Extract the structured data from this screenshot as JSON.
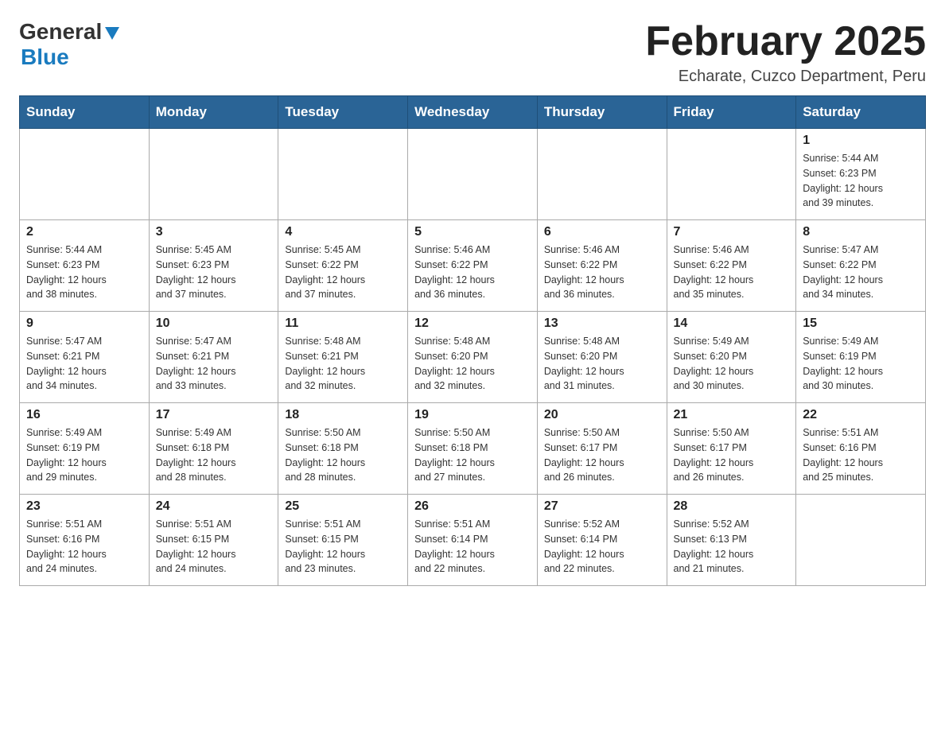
{
  "header": {
    "logo_general": "General",
    "logo_blue": "Blue",
    "month_title": "February 2025",
    "location": "Echarate, Cuzco Department, Peru"
  },
  "weekdays": [
    "Sunday",
    "Monday",
    "Tuesday",
    "Wednesday",
    "Thursday",
    "Friday",
    "Saturday"
  ],
  "weeks": [
    [
      {
        "day": "",
        "info": ""
      },
      {
        "day": "",
        "info": ""
      },
      {
        "day": "",
        "info": ""
      },
      {
        "day": "",
        "info": ""
      },
      {
        "day": "",
        "info": ""
      },
      {
        "day": "",
        "info": ""
      },
      {
        "day": "1",
        "info": "Sunrise: 5:44 AM\nSunset: 6:23 PM\nDaylight: 12 hours\nand 39 minutes."
      }
    ],
    [
      {
        "day": "2",
        "info": "Sunrise: 5:44 AM\nSunset: 6:23 PM\nDaylight: 12 hours\nand 38 minutes."
      },
      {
        "day": "3",
        "info": "Sunrise: 5:45 AM\nSunset: 6:23 PM\nDaylight: 12 hours\nand 37 minutes."
      },
      {
        "day": "4",
        "info": "Sunrise: 5:45 AM\nSunset: 6:22 PM\nDaylight: 12 hours\nand 37 minutes."
      },
      {
        "day": "5",
        "info": "Sunrise: 5:46 AM\nSunset: 6:22 PM\nDaylight: 12 hours\nand 36 minutes."
      },
      {
        "day": "6",
        "info": "Sunrise: 5:46 AM\nSunset: 6:22 PM\nDaylight: 12 hours\nand 36 minutes."
      },
      {
        "day": "7",
        "info": "Sunrise: 5:46 AM\nSunset: 6:22 PM\nDaylight: 12 hours\nand 35 minutes."
      },
      {
        "day": "8",
        "info": "Sunrise: 5:47 AM\nSunset: 6:22 PM\nDaylight: 12 hours\nand 34 minutes."
      }
    ],
    [
      {
        "day": "9",
        "info": "Sunrise: 5:47 AM\nSunset: 6:21 PM\nDaylight: 12 hours\nand 34 minutes."
      },
      {
        "day": "10",
        "info": "Sunrise: 5:47 AM\nSunset: 6:21 PM\nDaylight: 12 hours\nand 33 minutes."
      },
      {
        "day": "11",
        "info": "Sunrise: 5:48 AM\nSunset: 6:21 PM\nDaylight: 12 hours\nand 32 minutes."
      },
      {
        "day": "12",
        "info": "Sunrise: 5:48 AM\nSunset: 6:20 PM\nDaylight: 12 hours\nand 32 minutes."
      },
      {
        "day": "13",
        "info": "Sunrise: 5:48 AM\nSunset: 6:20 PM\nDaylight: 12 hours\nand 31 minutes."
      },
      {
        "day": "14",
        "info": "Sunrise: 5:49 AM\nSunset: 6:20 PM\nDaylight: 12 hours\nand 30 minutes."
      },
      {
        "day": "15",
        "info": "Sunrise: 5:49 AM\nSunset: 6:19 PM\nDaylight: 12 hours\nand 30 minutes."
      }
    ],
    [
      {
        "day": "16",
        "info": "Sunrise: 5:49 AM\nSunset: 6:19 PM\nDaylight: 12 hours\nand 29 minutes."
      },
      {
        "day": "17",
        "info": "Sunrise: 5:49 AM\nSunset: 6:18 PM\nDaylight: 12 hours\nand 28 minutes."
      },
      {
        "day": "18",
        "info": "Sunrise: 5:50 AM\nSunset: 6:18 PM\nDaylight: 12 hours\nand 28 minutes."
      },
      {
        "day": "19",
        "info": "Sunrise: 5:50 AM\nSunset: 6:18 PM\nDaylight: 12 hours\nand 27 minutes."
      },
      {
        "day": "20",
        "info": "Sunrise: 5:50 AM\nSunset: 6:17 PM\nDaylight: 12 hours\nand 26 minutes."
      },
      {
        "day": "21",
        "info": "Sunrise: 5:50 AM\nSunset: 6:17 PM\nDaylight: 12 hours\nand 26 minutes."
      },
      {
        "day": "22",
        "info": "Sunrise: 5:51 AM\nSunset: 6:16 PM\nDaylight: 12 hours\nand 25 minutes."
      }
    ],
    [
      {
        "day": "23",
        "info": "Sunrise: 5:51 AM\nSunset: 6:16 PM\nDaylight: 12 hours\nand 24 minutes."
      },
      {
        "day": "24",
        "info": "Sunrise: 5:51 AM\nSunset: 6:15 PM\nDaylight: 12 hours\nand 24 minutes."
      },
      {
        "day": "25",
        "info": "Sunrise: 5:51 AM\nSunset: 6:15 PM\nDaylight: 12 hours\nand 23 minutes."
      },
      {
        "day": "26",
        "info": "Sunrise: 5:51 AM\nSunset: 6:14 PM\nDaylight: 12 hours\nand 22 minutes."
      },
      {
        "day": "27",
        "info": "Sunrise: 5:52 AM\nSunset: 6:14 PM\nDaylight: 12 hours\nand 22 minutes."
      },
      {
        "day": "28",
        "info": "Sunrise: 5:52 AM\nSunset: 6:13 PM\nDaylight: 12 hours\nand 21 minutes."
      },
      {
        "day": "",
        "info": ""
      }
    ]
  ]
}
